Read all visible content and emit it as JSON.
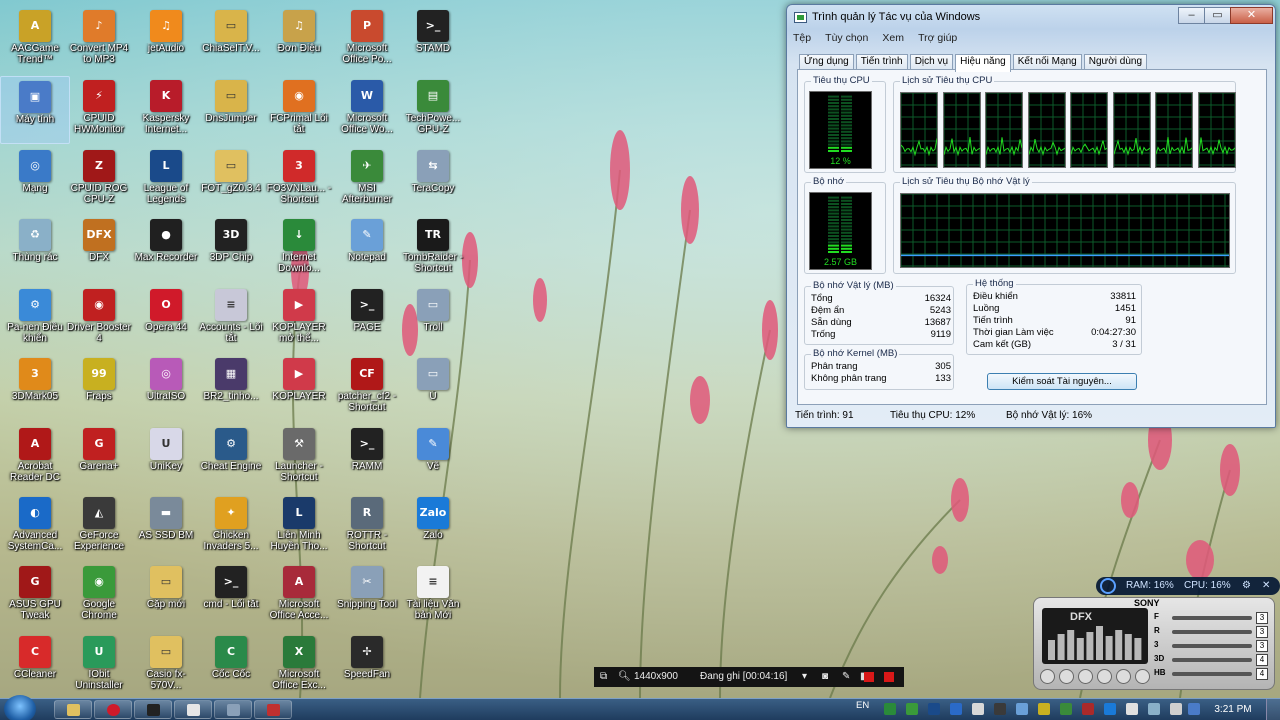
{
  "desktop": {
    "icons": [
      {
        "label": "AACGame Trend™",
        "color": "#c9a227",
        "glyph": "A"
      },
      {
        "label": "Convert MP4 to MP3",
        "color": "#e07b2a",
        "glyph": "♪"
      },
      {
        "label": "jetAudio",
        "color": "#f08a1c",
        "glyph": "♫"
      },
      {
        "label": "ChiaSeIT.V...",
        "color": "#d9b44a",
        "glyph": "▭"
      },
      {
        "label": "Đơn Điệu",
        "color": "#c8a24a",
        "glyph": "♫"
      },
      {
        "label": "Microsoft Office Po...",
        "color": "#c94a2e",
        "glyph": "P"
      },
      {
        "label": "STAMD",
        "color": "#222222",
        "glyph": ">_"
      },
      {
        "label": "Máy tính",
        "color": "#4a7bc8",
        "glyph": "▣"
      },
      {
        "label": "CPUID HWMonitor",
        "color": "#c02020",
        "glyph": "⚡"
      },
      {
        "label": "Kaspersky Internet...",
        "color": "#b81c2a",
        "glyph": "K"
      },
      {
        "label": "DnsJumper",
        "color": "#d9b44a",
        "glyph": "▭"
      },
      {
        "label": "FCPrimal Lối tắt",
        "color": "#e07020",
        "glyph": "◉"
      },
      {
        "label": "Microsoft Office Wo...",
        "color": "#2a5aa8",
        "glyph": "W"
      },
      {
        "label": "TechPowe... GPU-Z",
        "color": "#3a8a3a",
        "glyph": "▤"
      },
      {
        "label": "Mạng",
        "color": "#3a7ac8",
        "glyph": "◎"
      },
      {
        "label": "CPUID ROG CPU-Z",
        "color": "#a01818",
        "glyph": "Z"
      },
      {
        "label": "League of Legends",
        "color": "#1a4a8a",
        "glyph": "L"
      },
      {
        "label": "FOT_gZ0.3.4",
        "color": "#e0c060",
        "glyph": "▭"
      },
      {
        "label": "FO3VNLau... - Shortcut",
        "color": "#d02a2a",
        "glyph": "3"
      },
      {
        "label": "MSI Afterburner",
        "color": "#3a8a3a",
        "glyph": "✈"
      },
      {
        "label": "TeraCopy",
        "color": "#8aa0b8",
        "glyph": "⇆"
      },
      {
        "label": "Thùng rác",
        "color": "#8ab0c8",
        "glyph": "♻"
      },
      {
        "label": "DFX",
        "color": "#c07020",
        "glyph": "DFX"
      },
      {
        "label": "Max Recorder",
        "color": "#202020",
        "glyph": "●"
      },
      {
        "label": "3DP Chip",
        "color": "#222222",
        "glyph": "3D"
      },
      {
        "label": "Internet Downlo...",
        "color": "#2a8a3a",
        "glyph": "↓"
      },
      {
        "label": "Notepad",
        "color": "#6aa0d8",
        "glyph": "✎"
      },
      {
        "label": "TombRaider - Shortcut",
        "color": "#1a1a1a",
        "glyph": "TR"
      },
      {
        "label": "Pa-nen Điều khiển",
        "color": "#3a8ad8",
        "glyph": "⚙"
      },
      {
        "label": "Driver Booster 4",
        "color": "#c02020",
        "glyph": "◉"
      },
      {
        "label": "Opera 44",
        "color": "#d01a2a",
        "glyph": "O"
      },
      {
        "label": "Accounts - Lối tắt",
        "color": "#c8c8d8",
        "glyph": "≡"
      },
      {
        "label": "KOPLAYER mở thể...",
        "color": "#d03a4a",
        "glyph": "▶"
      },
      {
        "label": "PAGE",
        "color": "#222222",
        "glyph": ">_"
      },
      {
        "label": "Troll",
        "color": "#8aa0b8",
        "glyph": "▭"
      },
      {
        "label": "3DMark05",
        "color": "#e08a1a",
        "glyph": "3"
      },
      {
        "label": "Fraps",
        "color": "#c8b020",
        "glyph": "99"
      },
      {
        "label": "UltraISO",
        "color": "#b85ab8",
        "glyph": "◎"
      },
      {
        "label": "BR2_tinho...",
        "color": "#4a3a6a",
        "glyph": "▦"
      },
      {
        "label": "KOPLAYER",
        "color": "#d03a4a",
        "glyph": "▶"
      },
      {
        "label": "patcher_cf2 - Shortcut",
        "color": "#b01818",
        "glyph": "CF"
      },
      {
        "label": "Ú",
        "color": "#8aa0b8",
        "glyph": "▭"
      },
      {
        "label": "Acrobat Reader DC",
        "color": "#b01818",
        "glyph": "A"
      },
      {
        "label": "Garena+",
        "color": "#c02020",
        "glyph": "G"
      },
      {
        "label": "UniKey",
        "color": "#d8d8e8",
        "glyph": "U"
      },
      {
        "label": "Cheat Engine",
        "color": "#2a5a8a",
        "glyph": "⚙"
      },
      {
        "label": "Launcher - Shortcut",
        "color": "#6a6a6a",
        "glyph": "⚒"
      },
      {
        "label": "RAMM",
        "color": "#222222",
        "glyph": ">_"
      },
      {
        "label": "Vẽ",
        "color": "#4a8ad8",
        "glyph": "✎"
      },
      {
        "label": "Advanced SystemCa...",
        "color": "#1a6ac8",
        "glyph": "◐"
      },
      {
        "label": "GeForce Experience",
        "color": "#3a3a3a",
        "glyph": "◭"
      },
      {
        "label": "AS SSD BM",
        "color": "#7a8a9a",
        "glyph": "▬"
      },
      {
        "label": "Chicken Invaders 5...",
        "color": "#e0a020",
        "glyph": "✦"
      },
      {
        "label": "Liên Minh Huyền Tho...",
        "color": "#1a3a6a",
        "glyph": "L"
      },
      {
        "label": "ROTTR - Shortcut",
        "color": "#5a6a7a",
        "glyph": "R"
      },
      {
        "label": "Zalo",
        "color": "#1a7ad8",
        "glyph": "Zalo"
      },
      {
        "label": "ASUS GPU Tweak",
        "color": "#a01818",
        "glyph": "G"
      },
      {
        "label": "Google Chrome",
        "color": "#3a9a3a",
        "glyph": "◉"
      },
      {
        "label": "Cặp mới",
        "color": "#e0c060",
        "glyph": "▭"
      },
      {
        "label": "cmd - Lối tắt",
        "color": "#222222",
        "glyph": ">_"
      },
      {
        "label": "Microsoft Office Acce...",
        "color": "#a82a3a",
        "glyph": "A"
      },
      {
        "label": "Snipping Tool",
        "color": "#8aa0b8",
        "glyph": "✂"
      },
      {
        "label": "Tài liệu Văn bản Mới",
        "color": "#f2f2f2",
        "glyph": "≡"
      },
      {
        "label": "CCleaner",
        "color": "#d82a2a",
        "glyph": "C"
      },
      {
        "label": "IObit Uninstaller",
        "color": "#2a9a5a",
        "glyph": "U"
      },
      {
        "label": "Casio fx-570V...",
        "color": "#e0c060",
        "glyph": "▭"
      },
      {
        "label": "Cốc Cốc",
        "color": "#2a8a4a",
        "glyph": "C"
      },
      {
        "label": "Microsoft Office Exc...",
        "color": "#2a7a3a",
        "glyph": "X"
      },
      {
        "label": "SpeedFan",
        "color": "#2a2a2a",
        "glyph": "✢"
      }
    ]
  },
  "taskmgr": {
    "title": "Trình quản lý Tác vụ của Windows",
    "menu": [
      "Tệp",
      "Tùy chọn",
      "Xem",
      "Trợ giúp"
    ],
    "tabs": [
      "Ứng dụng",
      "Tiến trình",
      "Dịch vụ",
      "Hiệu năng",
      "Kết nối Mạng",
      "Người dùng"
    ],
    "active_tab": "Hiệu năng",
    "cpu_usage_title": "Tiêu thụ CPU",
    "cpu_usage_value": "12 %",
    "cpu_usage_level": 0.12,
    "cpu_history_title": "Lịch sử Tiêu thụ CPU",
    "mem_title": "Bộ nhớ",
    "mem_value": "2.57 GB",
    "mem_usage_level": 0.16,
    "mem_history_title": "Lịch sử Tiêu thụ Bộ nhớ Vật lý",
    "physical": {
      "title": "Bộ nhớ Vật lý (MB)",
      "rows": [
        [
          "Tổng",
          "16324"
        ],
        [
          "Đệm ẩn",
          "5243"
        ],
        [
          "Sẵn dùng",
          "13687"
        ],
        [
          "Trống",
          "9119"
        ]
      ]
    },
    "kernel": {
      "title": "Bộ nhớ Kernel (MB)",
      "rows": [
        [
          "Phân trang",
          "305"
        ],
        [
          "Không phân trang",
          "133"
        ]
      ]
    },
    "system": {
      "title": "Hệ thống",
      "rows": [
        [
          "Điều khiển",
          "33811"
        ],
        [
          "Luồng",
          "1451"
        ],
        [
          "Tiến trình",
          "91"
        ],
        [
          "Thời gian Làm việc",
          "0:04:27:30"
        ],
        [
          "Cam kết (GB)",
          "3 / 31"
        ]
      ]
    },
    "resource_button": "Kiểm soát Tài nguyên...",
    "status": {
      "processes": "Tiến trình: 91",
      "cpu": "Tiêu thụ CPU: 12%",
      "memory": "Bộ nhớ Vật lý: 16%"
    }
  },
  "recorder": {
    "resolution": "1440x900",
    "recording": "Đang ghi [00:04:16]"
  },
  "monitor": {
    "ram": "RAM: 16%",
    "cpu": "CPU: 16%"
  },
  "dfx": {
    "brand": "DFX",
    "maker": "SONY",
    "sliders": [
      {
        "label": "F",
        "value": "3"
      },
      {
        "label": "R",
        "value": "3"
      },
      {
        "label": "3",
        "value": "3"
      },
      {
        "label": "3D",
        "value": "4"
      },
      {
        "label": "HB",
        "value": "4"
      }
    ]
  },
  "taskbar": {
    "language": "EN",
    "clock": "3:21 PM"
  },
  "colors": {
    "graph_green": "#22dd22",
    "graph_grid": "#0d5a2a",
    "accent": "#3c7fb1"
  }
}
